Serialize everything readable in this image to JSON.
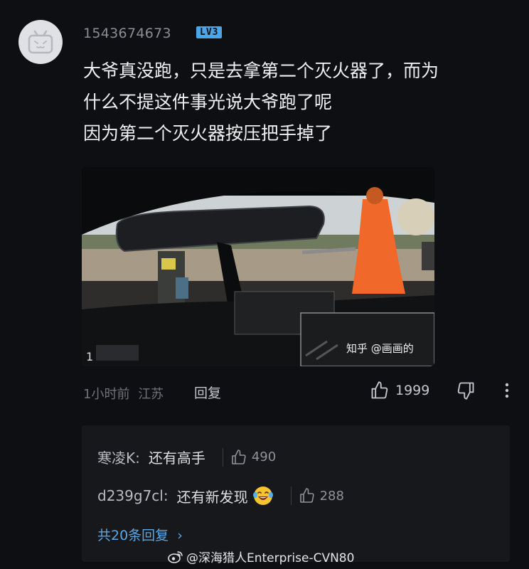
{
  "comment": {
    "username": "1543674673",
    "level": "LV3",
    "lines": [
      "大爷真没跑，只是去拿第二个灭火器了，而为",
      "什么不提这件事光说大爷跑了呢",
      "因为第二个灭火器按压把手掉了"
    ],
    "media_watermark": "知乎 @画画的",
    "media_counter": "1",
    "time": "1小时前",
    "location": "江苏",
    "reply_label": "回复",
    "like_count": "1999"
  },
  "replies": {
    "items": [
      {
        "user": "寒凌K:",
        "text": "还有高手",
        "likes": "490"
      },
      {
        "user": "d239g7cl:",
        "text": "还有新发现",
        "likes": "288",
        "emoji": "laughing-tears"
      }
    ],
    "see_all": "共20条回复"
  },
  "watermark": {
    "text": "@深海猎人Enterprise-CVN80",
    "icon": "weibo-icon"
  },
  "colors": {
    "background": "#0e0f12",
    "level_badge": "#4aa6e8",
    "link": "#5aa7e6",
    "reply_panel": "#17181c"
  }
}
